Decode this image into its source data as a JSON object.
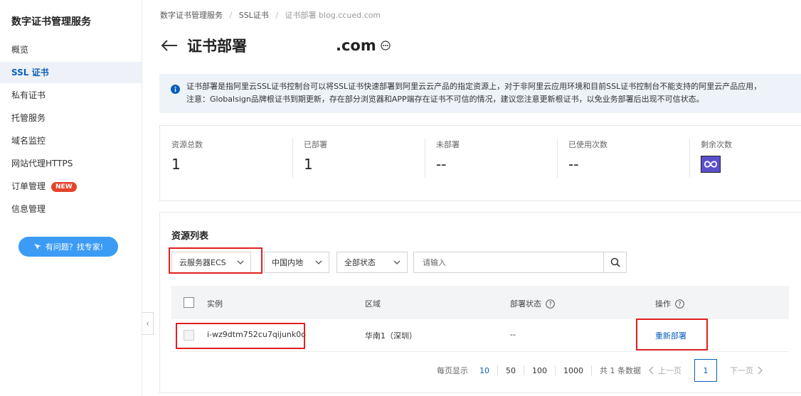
{
  "sidebar": {
    "title": "数字证书管理服务",
    "items": [
      {
        "label": "概览"
      },
      {
        "label": "SSL 证书"
      },
      {
        "label": "私有证书"
      },
      {
        "label": "托管服务"
      },
      {
        "label": "域名监控"
      },
      {
        "label": "网站代理HTTPS"
      },
      {
        "label": "订单管理",
        "badge": "NEW"
      },
      {
        "label": "信息管理"
      }
    ],
    "help_button": "有问题？找专家!"
  },
  "breadcrumb": {
    "items": [
      "数字证书管理服务",
      "SSL证书"
    ],
    "current": "证书部署",
    "watermark": "blog.ccued.com"
  },
  "header": {
    "title": "证书部署",
    "domain": ".com"
  },
  "notice": {
    "line1": "证书部署是指阿里云SSL证书控制台可以将SSL证书快速部署到阿里云云产品的指定资源上，对于非阿里云应用环境和目前SSL证书控制台不能支持的阿里云产品应用，",
    "line2": "注意：Globalsign品牌根证书到期更新，存在部分浏览器和APP端存在证书不可信的情况，建议您注意更新根证书，以免业务部署后出现不可信状态。"
  },
  "stats": [
    {
      "label": "资源总数",
      "value": "1"
    },
    {
      "label": "已部署",
      "value": "1"
    },
    {
      "label": "未部署",
      "value": "--"
    },
    {
      "label": "已使用次数",
      "value": "--"
    },
    {
      "label": "剩余次数",
      "icon": "infinity-icon"
    }
  ],
  "resources": {
    "title": "资源列表",
    "filters": {
      "product": "云服务器ECS",
      "region": "中国内地",
      "status": "全部状态",
      "search_placeholder": "请输入"
    },
    "columns": [
      "实例",
      "区域",
      "部署状态",
      "操作"
    ],
    "rows": [
      {
        "instance": "i-wz9dtm752cu7qijunk0o",
        "region": "华南1（深圳）",
        "status": "--",
        "action": "重新部署"
      }
    ]
  },
  "pagination": {
    "per_page_label": "每页显示",
    "sizes": [
      "10",
      "50",
      "100",
      "1000"
    ],
    "selected_size": "10",
    "total": "共 1 条数据",
    "prev": "上一页",
    "current_page": "1",
    "next": "下一页"
  },
  "colors": {
    "accent": "#0a5fba",
    "highlight": "#e02020",
    "badge": "#e5432c",
    "notice_bg": "#eef3fa",
    "help_button": "#3b9bf5",
    "infinity_bg": "#5b4fcb"
  }
}
